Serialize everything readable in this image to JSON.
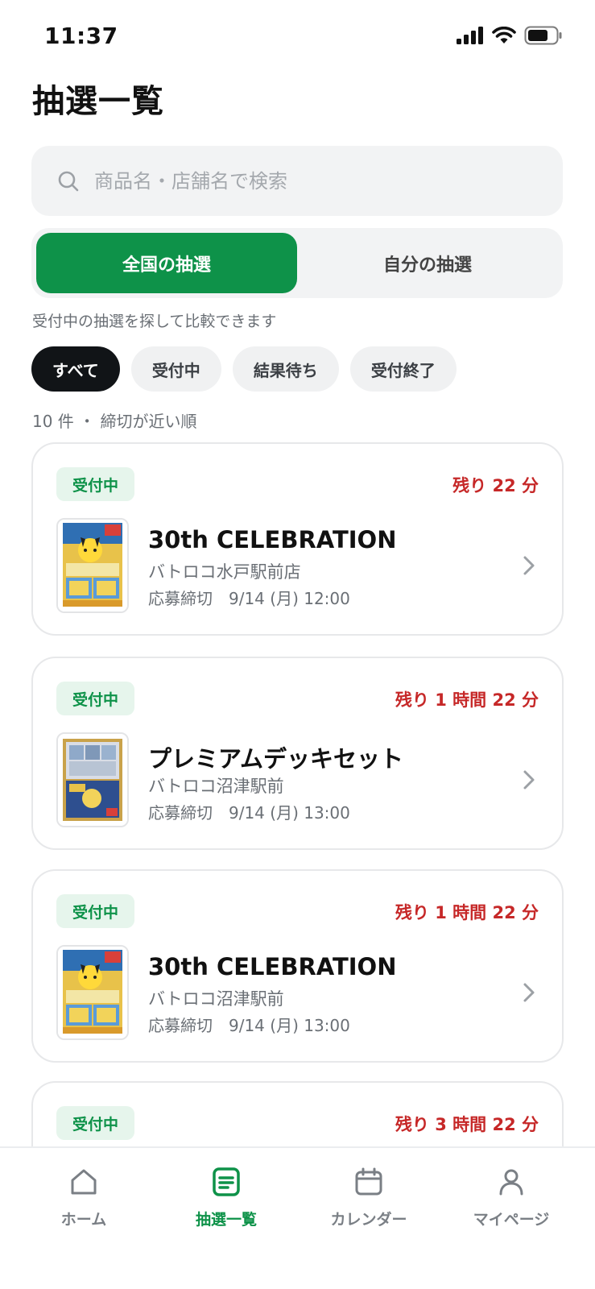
{
  "status_bar": {
    "time": "11:37"
  },
  "page": {
    "title": "抽選一覧"
  },
  "search": {
    "placeholder": "商品名・店舗名で検索"
  },
  "segment": {
    "tabs": [
      "全国の抽選",
      "自分の抽選"
    ],
    "active_index": 0
  },
  "subtitle": "受付中の抽選を探して比較できます",
  "filters": {
    "chips": [
      "すべて",
      "受付中",
      "結果待ち",
      "受付終了"
    ],
    "active_index": 0
  },
  "results": {
    "info": "10 件 ・ 締切が近い順"
  },
  "lotteries": [
    {
      "status": "受付中",
      "remaining": "残り 22 分",
      "title": "30th CELEBRATION",
      "store": "バトロコ水戸駅前店",
      "deadline": "応募締切　9/14 (月) 12:00",
      "image": "booster-box"
    },
    {
      "status": "受付中",
      "remaining": "残り 1 時間 22 分",
      "title": "プレミアムデッキセット",
      "store": "バトロコ沼津駅前",
      "deadline": "応募締切　9/14 (月) 13:00",
      "image": "deck-box"
    },
    {
      "status": "受付中",
      "remaining": "残り 1 時間 22 分",
      "title": "30th CELEBRATION",
      "store": "バトロコ沼津駅前",
      "deadline": "応募締切　9/14 (月) 13:00",
      "image": "booster-box"
    },
    {
      "status": "受付中",
      "remaining": "残り 3 時間 22 分"
    }
  ],
  "bottom_nav": {
    "items": [
      {
        "label": "ホーム",
        "icon": "home-icon"
      },
      {
        "label": "抽選一覧",
        "icon": "list-icon"
      },
      {
        "label": "カレンダー",
        "icon": "calendar-icon"
      },
      {
        "label": "マイページ",
        "icon": "person-icon"
      }
    ],
    "active_index": 1
  },
  "colors": {
    "accent": "#0e9249",
    "alert": "#c62828",
    "badge_bg": "#e6f5ec"
  }
}
